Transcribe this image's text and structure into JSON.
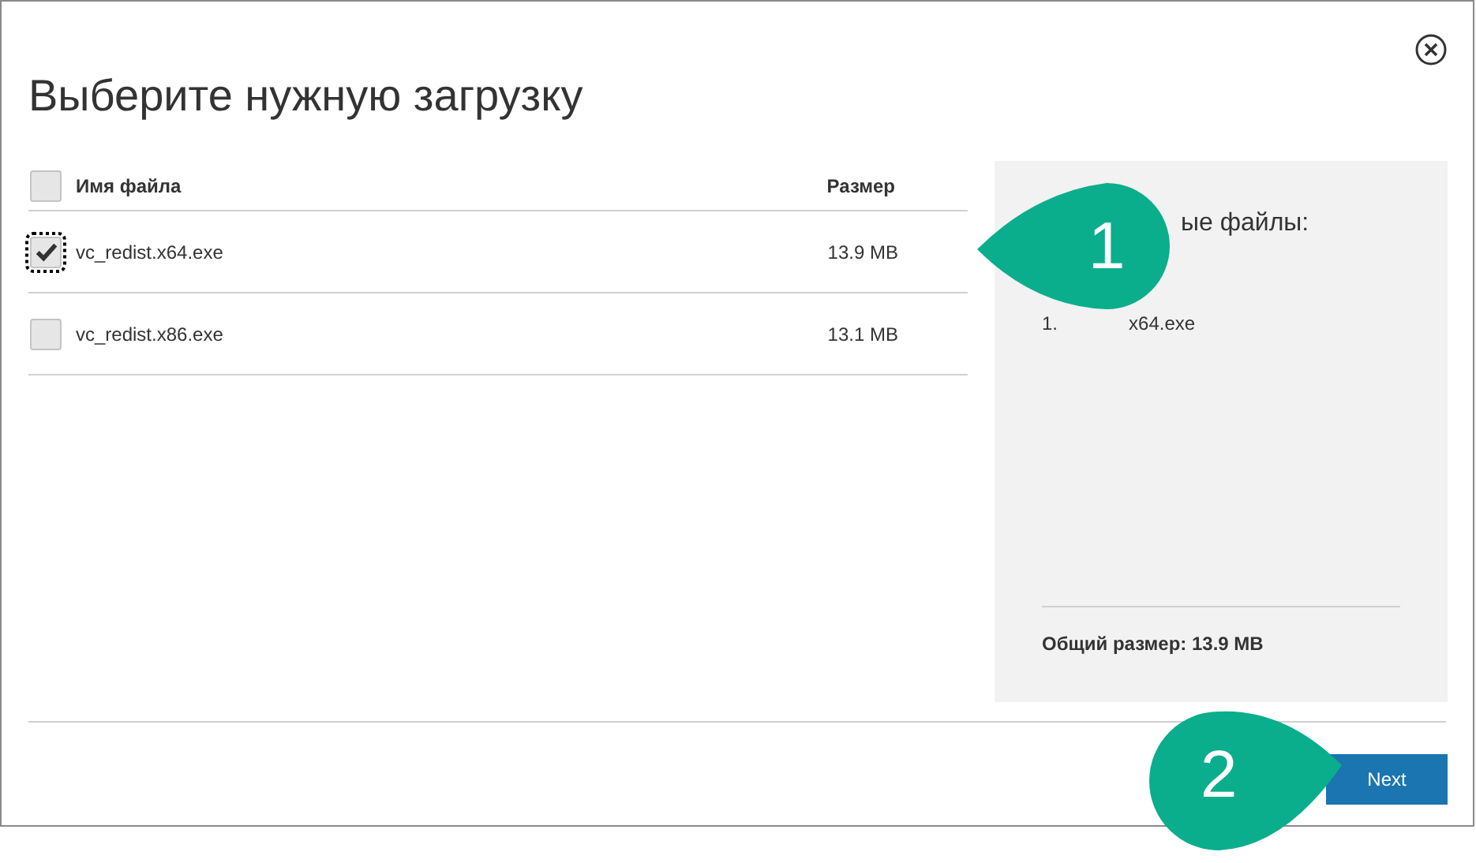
{
  "dialog": {
    "title": "Выберите нужную загрузку"
  },
  "table": {
    "columns": [
      {
        "label": "Имя файла"
      },
      {
        "label": "Размер"
      }
    ],
    "select_all": {
      "checked": false
    },
    "rows": [
      {
        "name": "vc_redist.x64.exe",
        "size": "13.9 MB",
        "checked": true,
        "focused": true
      },
      {
        "name": "vc_redist.x86.exe",
        "size": "13.1 MB",
        "checked": false,
        "focused": false
      }
    ]
  },
  "selected_panel": {
    "heading": "ые файлы:",
    "items": [
      {
        "number": "1.",
        "name": "x64.exe"
      }
    ],
    "total": "Общий размер: 13.9 MB"
  },
  "buttons": [
    {
      "label": "Next"
    }
  ],
  "callouts": [
    {
      "number": "1",
      "kind": "left"
    },
    {
      "number": "2",
      "kind": "right"
    }
  ]
}
